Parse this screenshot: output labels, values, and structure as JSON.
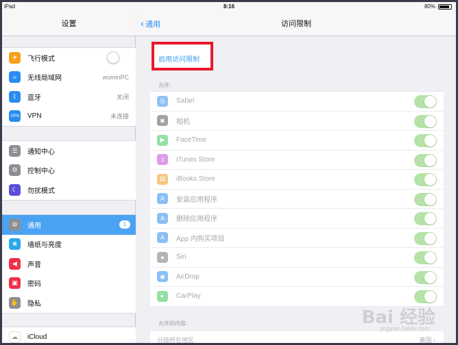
{
  "status": {
    "device": "iPad",
    "time": "8:16",
    "battery": "80%"
  },
  "sidebar": {
    "title": "设置",
    "group1": [
      {
        "label": "飞行模式",
        "value": "",
        "icon": "airplane-icon",
        "color": "#f7a01b"
      },
      {
        "label": "无线局域网",
        "value": "wuminPC",
        "icon": "wifi-icon",
        "color": "#2a8cf0"
      },
      {
        "label": "蓝牙",
        "value": "关闭",
        "icon": "bluetooth-icon",
        "color": "#2a8cf0"
      },
      {
        "label": "VPN",
        "value": "未连接",
        "icon": "vpn-icon",
        "color": "#2a8cf0"
      }
    ],
    "group2": [
      {
        "label": "通知中心",
        "icon": "notifications-icon",
        "color": "#8e8e93"
      },
      {
        "label": "控制中心",
        "icon": "control-center-icon",
        "color": "#8e8e93"
      },
      {
        "label": "勿扰模式",
        "icon": "moon-icon",
        "color": "#5a4fd6"
      }
    ],
    "group3": [
      {
        "label": "通用",
        "badge": "1",
        "icon": "gear-icon",
        "color": "#8e8e93"
      },
      {
        "label": "墙纸与亮度",
        "icon": "wallpaper-icon",
        "color": "#2aa8e8"
      },
      {
        "label": "声音",
        "icon": "sound-icon",
        "color": "#f0304a"
      },
      {
        "label": "密码",
        "icon": "lock-icon",
        "color": "#f0304a"
      },
      {
        "label": "隐私",
        "icon": "hand-icon",
        "color": "#8e8e93"
      }
    ],
    "group4": [
      {
        "label": "iCloud",
        "icon": "cloud-icon",
        "color": "#ffffff"
      }
    ]
  },
  "main": {
    "back_label": "通用",
    "title": "访问限制",
    "enable_label": "启用访问限制",
    "allow_label": "允许:",
    "items": [
      {
        "label": "Safari",
        "icon": "compass-icon",
        "color": "#3a8ee8"
      },
      {
        "label": "相机",
        "icon": "camera-icon",
        "color": "#555555"
      },
      {
        "label": "FaceTime",
        "icon": "video-icon",
        "color": "#3cc85a"
      },
      {
        "label": "iTunes Store",
        "icon": "music-icon",
        "color": "#c34ad8"
      },
      {
        "label": "iBooks Store",
        "icon": "book-icon",
        "color": "#f09a1a"
      },
      {
        "label": "安装应用程序",
        "icon": "app-store-icon",
        "color": "#2a8cf0"
      },
      {
        "label": "删除应用程序",
        "icon": "app-store-icon",
        "color": "#2a8cf0"
      },
      {
        "label": "App 内购买项目",
        "icon": "app-store-icon",
        "color": "#2a8cf0"
      },
      {
        "label": "Siri",
        "icon": "microphone-icon",
        "color": "#777777"
      },
      {
        "label": "AirDrop",
        "icon": "airdrop-icon",
        "color": "#2a8cf0"
      },
      {
        "label": "CarPlay",
        "icon": "carplay-icon",
        "color": "#3cc85a"
      }
    ],
    "content_label": "允许的内容:",
    "region_label": "分级所在地区",
    "region_value": "美国",
    "accent": "#2a8cf0",
    "toggle_on": "#4cd964"
  },
  "watermark": {
    "text": "Bai 经验",
    "sub": "jingyan.baidu.com"
  }
}
